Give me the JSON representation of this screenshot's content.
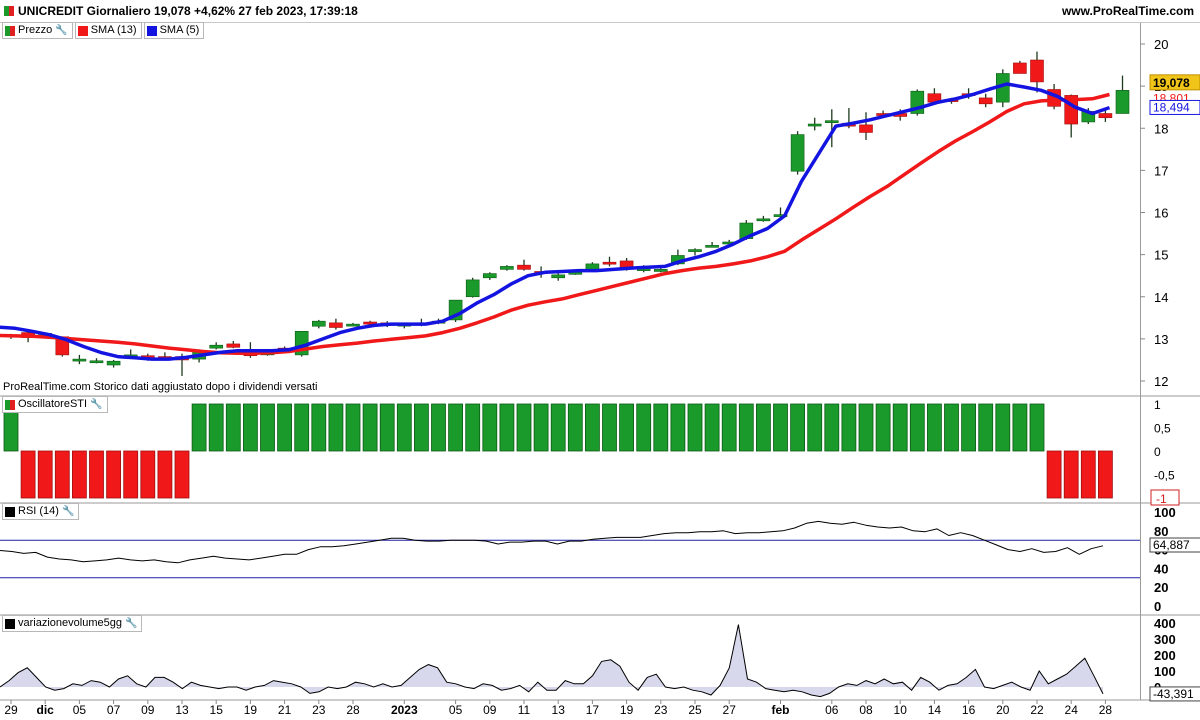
{
  "header": {
    "title": "UNICREDIT Giornaliero 19,078 +4,62% 27 feb 2023, 17:39:18",
    "site": "www.ProRealTime.com"
  },
  "legend": {
    "price": "Prezzo",
    "sma13": "SMA (13)",
    "sma5": "SMA (5)"
  },
  "note": "ProRealTime.com  Storico dati aggiustato dopo i dividendi versati",
  "panels": {
    "sti": "OscillatoreSTI",
    "rsi": "RSI (14)",
    "vol": "variazionevolume5gg"
  },
  "colors": {
    "up": "#1a9a2a",
    "down": "#f01818",
    "sma13": "#f01818",
    "sma5": "#1414e0",
    "rsi_band": "#2020a0",
    "vol_fill": "#d8d8ec"
  },
  "chart_data": [
    {
      "type": "candlestick",
      "title": "UNICREDIT Giornaliero",
      "ylim": [
        11.7,
        20.5
      ],
      "yticks": [
        "20",
        "19",
        "18",
        "17",
        "16",
        "15",
        "14",
        "13",
        "12"
      ],
      "x_labels": [
        "29",
        "dic",
        "05",
        "07",
        "09",
        "13",
        "15",
        "19",
        "21",
        "23",
        "28",
        "2023",
        "05",
        "09",
        "11",
        "13",
        "17",
        "19",
        "23",
        "25",
        "27",
        "feb",
        "06",
        "08",
        "10",
        "14",
        "16",
        "20",
        "22",
        "24",
        "28"
      ],
      "x_label_index": [
        0,
        2,
        4,
        6,
        8,
        10,
        12,
        14,
        16,
        18,
        20,
        23,
        26,
        28,
        30,
        32,
        34,
        36,
        38,
        40,
        42,
        45,
        48,
        50,
        52,
        54,
        56,
        58,
        60,
        62,
        64
      ],
      "ohlc": [
        [
          13.05,
          13.12,
          13.0,
          13.1
        ],
        [
          13.15,
          13.18,
          12.92,
          13.03
        ],
        [
          13.12,
          13.15,
          13.08,
          13.13
        ],
        [
          13.05,
          13.06,
          12.58,
          12.62
        ],
        [
          12.52,
          12.62,
          12.4,
          12.52
        ],
        [
          12.44,
          12.54,
          12.42,
          12.48
        ],
        [
          12.38,
          12.5,
          12.32,
          12.47
        ],
        [
          12.58,
          12.75,
          12.55,
          12.62
        ],
        [
          12.6,
          12.65,
          12.48,
          12.52
        ],
        [
          12.58,
          12.68,
          12.52,
          12.55
        ],
        [
          12.58,
          12.65,
          12.12,
          12.5
        ],
        [
          12.52,
          12.75,
          12.44,
          12.7
        ],
        [
          12.78,
          12.92,
          12.75,
          12.85
        ],
        [
          12.88,
          12.95,
          12.78,
          12.8
        ],
        [
          12.72,
          12.92,
          12.55,
          12.6
        ],
        [
          12.62,
          12.76,
          12.6,
          12.72
        ],
        [
          12.78,
          12.82,
          12.68,
          12.7
        ],
        [
          12.62,
          12.72,
          12.58,
          13.18
        ],
        [
          13.3,
          13.45,
          13.25,
          13.42
        ],
        [
          13.38,
          13.48,
          13.22,
          13.27
        ],
        [
          13.33,
          13.38,
          13.3,
          13.35
        ],
        [
          13.4,
          13.43,
          13.3,
          13.35
        ],
        [
          13.38,
          13.42,
          13.28,
          13.32
        ],
        [
          13.32,
          13.38,
          13.25,
          13.35
        ],
        [
          13.38,
          13.48,
          13.3,
          13.35
        ],
        [
          13.42,
          13.48,
          13.35,
          13.42
        ],
        [
          13.45,
          13.92,
          13.4,
          13.92
        ],
        [
          14.0,
          14.45,
          13.98,
          14.4
        ],
        [
          14.45,
          14.58,
          14.4,
          14.55
        ],
        [
          14.65,
          14.75,
          14.62,
          14.72
        ],
        [
          14.75,
          14.88,
          14.62,
          14.65
        ],
        [
          14.6,
          14.72,
          14.45,
          14.55
        ],
        [
          14.45,
          14.6,
          14.38,
          14.52
        ],
        [
          14.58,
          14.65,
          14.52,
          14.58
        ],
        [
          14.65,
          14.82,
          14.6,
          14.78
        ],
        [
          14.82,
          14.95,
          14.72,
          14.78
        ],
        [
          14.85,
          14.92,
          14.62,
          14.7
        ],
        [
          14.62,
          14.75,
          14.58,
          14.7
        ],
        [
          14.6,
          14.68,
          14.58,
          14.65
        ],
        [
          14.78,
          15.12,
          14.75,
          14.98
        ],
        [
          15.08,
          15.15,
          14.98,
          15.12
        ],
        [
          15.22,
          15.3,
          15.18,
          15.22
        ],
        [
          15.28,
          15.35,
          15.18,
          15.3
        ],
        [
          15.38,
          15.82,
          15.35,
          15.75
        ],
        [
          15.85,
          15.92,
          15.78,
          15.85
        ],
        [
          15.95,
          16.12,
          15.88,
          15.95
        ],
        [
          16.98,
          17.93,
          16.9,
          17.85
        ],
        [
          18.08,
          18.25,
          17.95,
          18.1
        ],
        [
          18.15,
          18.45,
          17.55,
          18.18
        ],
        [
          18.12,
          18.48,
          18.0,
          18.05
        ],
        [
          18.08,
          18.38,
          17.72,
          17.9
        ],
        [
          18.35,
          18.42,
          18.25,
          18.33
        ],
        [
          18.35,
          18.45,
          18.18,
          18.28
        ],
        [
          18.35,
          18.92,
          18.3,
          18.88
        ],
        [
          18.82,
          18.95,
          18.62,
          18.62
        ],
        [
          18.68,
          18.72,
          18.58,
          18.65
        ],
        [
          18.82,
          18.95,
          18.7,
          18.78
        ],
        [
          18.72,
          18.82,
          18.5,
          18.58
        ],
        [
          18.62,
          19.4,
          18.5,
          19.3
        ],
        [
          19.55,
          19.6,
          19.3,
          19.3
        ],
        [
          19.62,
          19.82,
          18.85,
          19.1
        ],
        [
          18.92,
          19.05,
          18.45,
          18.52
        ],
        [
          18.78,
          18.8,
          17.78,
          18.1
        ],
        [
          18.15,
          18.48,
          18.1,
          18.4
        ],
        [
          18.35,
          18.45,
          18.15,
          18.25
        ],
        [
          18.35,
          19.25,
          18.35,
          18.9
        ]
      ],
      "sma13": [
        13.08,
        13.07,
        13.06,
        13.04,
        13.01,
        12.98,
        12.95,
        12.92,
        12.88,
        12.83,
        12.78,
        12.74,
        12.7,
        12.67,
        12.66,
        12.66,
        12.67,
        12.7,
        12.76,
        12.82,
        12.86,
        12.9,
        12.95,
        12.99,
        13.03,
        13.07,
        13.15,
        13.25,
        13.38,
        13.52,
        13.68,
        13.8,
        13.88,
        13.95,
        14.05,
        14.15,
        14.25,
        14.35,
        14.45,
        14.55,
        14.62,
        14.68,
        14.72,
        14.78,
        14.85,
        14.95,
        15.08,
        15.35,
        15.6,
        15.85,
        16.12,
        16.38,
        16.62,
        16.9,
        17.18,
        17.45,
        17.7,
        17.92,
        18.15,
        18.4,
        18.58,
        18.65,
        18.67,
        18.68,
        18.7,
        18.8
      ],
      "sma5": [
        13.28,
        13.25,
        13.18,
        13.1,
        12.98,
        12.82,
        12.68,
        12.58,
        12.55,
        12.52,
        12.52,
        12.56,
        12.62,
        12.68,
        12.72,
        12.72,
        12.72,
        12.74,
        12.85,
        13.0,
        13.15,
        13.25,
        13.32,
        13.35,
        13.35,
        13.35,
        13.42,
        13.6,
        13.85,
        14.05,
        14.3,
        14.5,
        14.58,
        14.6,
        14.62,
        14.62,
        14.65,
        14.68,
        14.7,
        14.72,
        14.85,
        14.95,
        15.08,
        15.25,
        15.45,
        15.62,
        15.92,
        16.75,
        17.4,
        18.05,
        18.12,
        18.2,
        18.3,
        18.4,
        18.5,
        18.62,
        18.7,
        18.8,
        18.93,
        19.05,
        18.98,
        18.9,
        18.75,
        18.5,
        18.35,
        18.49
      ],
      "last_price_label": "19,078",
      "sma13_label": "18,801",
      "sma5_label": "18,494"
    },
    {
      "type": "bar",
      "title": "OscillatoreSTI",
      "ylim": [
        -1,
        1
      ],
      "yticks": [
        "1",
        "0,5",
        "0",
        "-0,5",
        "-1"
      ],
      "values": [
        1,
        -1,
        -1,
        -1,
        -1,
        -1,
        -1,
        -1,
        -1,
        -1,
        -1,
        1,
        1,
        1,
        1,
        1,
        1,
        1,
        1,
        1,
        1,
        1,
        1,
        1,
        1,
        1,
        1,
        1,
        1,
        1,
        1,
        1,
        1,
        1,
        1,
        1,
        1,
        1,
        1,
        1,
        1,
        1,
        1,
        1,
        1,
        1,
        1,
        1,
        1,
        1,
        1,
        1,
        1,
        1,
        1,
        1,
        1,
        1,
        1,
        1,
        1,
        -1,
        -1,
        -1,
        -1
      ]
    },
    {
      "type": "line",
      "title": "RSI (14)",
      "ylim": [
        0,
        100
      ],
      "yticks": [
        "100",
        "80",
        "60",
        "40",
        "20",
        "0"
      ],
      "bands": [
        70,
        30
      ],
      "last_label": "64,887",
      "values": [
        59,
        58,
        56,
        57,
        52,
        50,
        49,
        47,
        48,
        49,
        51,
        49,
        48,
        49,
        47,
        46,
        49,
        51,
        53,
        51,
        50,
        49,
        51,
        53,
        55,
        55,
        60,
        63,
        63,
        64,
        66,
        68,
        70,
        72,
        72,
        70,
        69,
        69,
        70,
        70,
        70,
        69,
        66,
        68,
        68,
        69,
        69,
        66,
        69,
        69,
        71,
        72,
        73,
        73,
        73,
        75,
        77,
        78,
        78,
        79,
        79,
        80,
        77,
        78,
        78,
        79,
        80,
        83,
        88,
        90,
        88,
        87,
        89,
        86,
        84,
        83,
        84,
        80,
        79,
        82,
        75,
        78,
        75,
        70,
        65,
        60,
        58,
        61,
        57,
        58,
        62,
        55,
        61,
        64
      ]
    },
    {
      "type": "area",
      "title": "variazionevolume5gg",
      "ylim": [
        -43.391,
        400
      ],
      "yticks": [
        "400",
        "300",
        "200",
        "100",
        "0"
      ],
      "last_label": "-43,391",
      "values": [
        0,
        40,
        90,
        120,
        60,
        0,
        -20,
        -10,
        20,
        10,
        40,
        30,
        0,
        50,
        70,
        20,
        0,
        60,
        60,
        30,
        -10,
        30,
        10,
        0,
        -10,
        0,
        0,
        -20,
        0,
        10,
        40,
        30,
        20,
        0,
        -40,
        -30,
        0,
        -10,
        0,
        30,
        20,
        0,
        20,
        0,
        10,
        60,
        110,
        140,
        120,
        30,
        20,
        0,
        -10,
        20,
        10,
        -20,
        -10,
        10,
        -30,
        30,
        -20,
        -20,
        40,
        20,
        20,
        70,
        160,
        170,
        130,
        30,
        -20,
        60,
        80,
        0,
        -10,
        0,
        -20,
        -30,
        -50,
        10,
        120,
        390,
        50,
        30,
        -10,
        -20,
        -30,
        -20,
        -30,
        -50,
        -60,
        -40,
        0,
        20,
        10,
        40,
        20,
        50,
        20,
        30,
        -20,
        60,
        30,
        -20,
        10,
        20,
        60,
        110,
        0,
        -10,
        10,
        30,
        0,
        -20,
        100,
        20,
        50,
        80,
        130,
        180,
        70,
        -43.391
      ]
    }
  ]
}
